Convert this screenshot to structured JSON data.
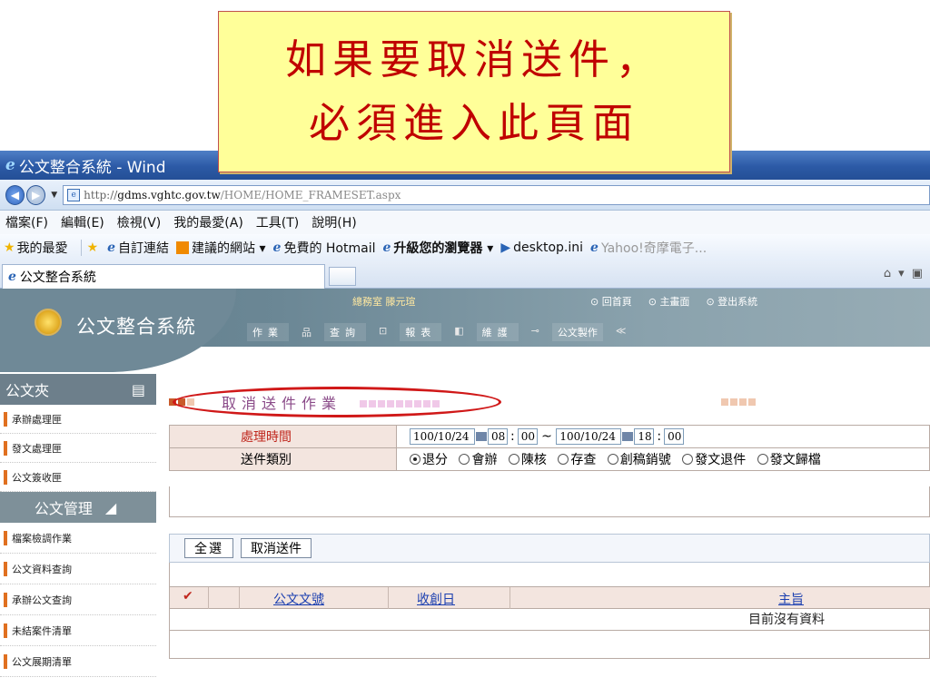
{
  "callout": {
    "line1": "如果要取消送件，",
    "line2": "必須進入此頁面"
  },
  "window": {
    "title": "公文整合系統 - Wind"
  },
  "address": {
    "proto": "http://",
    "host": "gdms.vghtc.gov.tw",
    "path": "/HOME/HOME_FRAMESET.aspx"
  },
  "menu": [
    "檔案(F)",
    "編輯(E)",
    "檢視(V)",
    "我的最愛(A)",
    "工具(T)",
    "說明(H)"
  ],
  "favorites": {
    "fav": "我的最愛",
    "custom": "自訂連結",
    "suggested": "建議的網站 ▾",
    "hotmail": "免費的 Hotmail",
    "upgrade": "升級您的瀏覽器 ▾",
    "desktop": "desktop.ini",
    "yahoo": "Yahoo!奇摩電子..."
  },
  "tab": {
    "label": "公文整合系統"
  },
  "app": {
    "title": "公文整合系統",
    "user": "總務室 滕元瑄",
    "links": [
      "回首頁",
      "主畫面",
      "登出系統"
    ],
    "nav": [
      "作業",
      "查詢",
      "報表",
      "維護",
      "公文製作"
    ]
  },
  "sidebar": {
    "head1": "公文夾",
    "items1": [
      "承辦處理匣",
      "發文處理匣",
      "公文簽收匣"
    ],
    "head2": "公文管理",
    "items2": [
      "檔案檢調作業",
      "公文資料查詢",
      "承辦公文查詢",
      "未結案件清單",
      "公文展期清單"
    ]
  },
  "section": {
    "title": "取消送件作業"
  },
  "form": {
    "time_label": "處理時間",
    "date_from": "100/10/24",
    "hour_from": "08",
    "min_from": "00",
    "tilde": "~",
    "date_to": "100/10/24",
    "hour_to": "18",
    "min_to": "00",
    "type_label": "送件類別",
    "types": [
      "退分",
      "會辦",
      "陳核",
      "存查",
      "創稿銷號",
      "發文退件",
      "發文歸檔"
    ],
    "selected_type": "退分"
  },
  "buttons": {
    "select_all": "全選",
    "cancel_send": "取消送件"
  },
  "results": {
    "columns": [
      "公文文號",
      "收創日",
      "主旨"
    ],
    "empty": "目前沒有資料"
  }
}
